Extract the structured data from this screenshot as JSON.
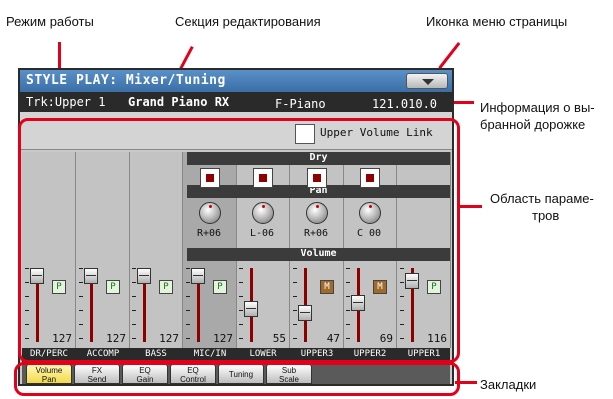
{
  "annotations": {
    "mode": "Режим работы",
    "edit_section": "Секция редактирования",
    "page_menu_icon": "Иконка меню страницы",
    "track_info": [
      "Информация о вы-",
      "бранной дорожке"
    ],
    "parameter_area": [
      "Область параме-",
      "тров"
    ],
    "tabs": "Закладки"
  },
  "colors": {
    "callout": "#e3001b",
    "title_bar": "#3a6ea6",
    "active_tab": "#f3d84b",
    "fader_track": "#8c0000",
    "dry_on": "#8f0000"
  },
  "title": "STYLE PLAY: Mixer/Tuning",
  "menu_icon": "triangle-down-icon",
  "info": {
    "track": "Trk:Upper 1",
    "sound": "Grand Piano RX",
    "category": "F-Piano",
    "number": "121.010.0"
  },
  "upper_volume_link": {
    "label": "Upper Volume Link",
    "checked": false
  },
  "sections": {
    "dry": "Dry",
    "pan": "Pan",
    "volume": "Volume"
  },
  "channels": [
    {
      "name": "DR/PERC",
      "volume": "127",
      "level": 1.0,
      "btn": "P",
      "pan": null,
      "dry": null,
      "selected": false
    },
    {
      "name": "ACCOMP",
      "volume": "127",
      "level": 1.0,
      "btn": "P",
      "pan": null,
      "dry": null,
      "selected": false
    },
    {
      "name": "BASS",
      "volume": "127",
      "level": 1.0,
      "btn": "P",
      "pan": null,
      "dry": null,
      "selected": false
    },
    {
      "name": "MIC/IN",
      "volume": "127",
      "level": 1.0,
      "btn": "P",
      "pan": "R+06",
      "dry": "on",
      "selected": true
    },
    {
      "name": "LOWER",
      "volume": "55",
      "level": 0.43,
      "btn": null,
      "pan": "L-06",
      "dry": "on",
      "selected": false
    },
    {
      "name": "UPPER3",
      "volume": "47",
      "level": 0.37,
      "btn": "M",
      "pan": "R+06",
      "dry": "on",
      "selected": false
    },
    {
      "name": "UPPER2",
      "volume": "69",
      "level": 0.54,
      "btn": "M",
      "pan": "C 00",
      "dry": "on",
      "selected": false
    },
    {
      "name": "UPPER1",
      "volume": "116",
      "level": 0.91,
      "btn": "P",
      "pan": null,
      "dry": null,
      "selected": false
    }
  ],
  "tabs": [
    {
      "lines": [
        "Volume",
        "Pan"
      ],
      "active": true
    },
    {
      "lines": [
        "FX",
        "Send"
      ],
      "active": false
    },
    {
      "lines": [
        "EQ",
        "Gain"
      ],
      "active": false
    },
    {
      "lines": [
        "EQ",
        "Control"
      ],
      "active": false
    },
    {
      "lines": [
        "Tuning"
      ],
      "active": false
    },
    {
      "lines": [
        "Sub",
        "Scale"
      ],
      "active": false
    }
  ]
}
